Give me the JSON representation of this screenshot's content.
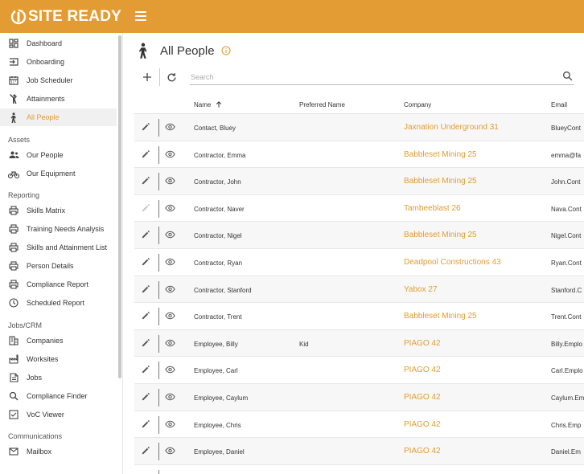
{
  "app": {
    "brand": "SITE READY"
  },
  "colors": {
    "accent": "#E39C33"
  },
  "sidebar": {
    "items": [
      {
        "label": "Dashboard",
        "icon": "dashboard-icon"
      },
      {
        "label": "Onboarding",
        "icon": "login-icon"
      },
      {
        "label": "Job Scheduler",
        "icon": "calendar-icon"
      },
      {
        "label": "Attainments",
        "icon": "person-pose-icon"
      },
      {
        "label": "All People",
        "icon": "person-walking-icon",
        "active": true
      }
    ],
    "sections": {
      "assets": {
        "title": "Assets",
        "items": [
          {
            "label": "Our People",
            "icon": "people-icon"
          },
          {
            "label": "Our Equipment",
            "icon": "bike-icon"
          }
        ]
      },
      "reporting": {
        "title": "Reporting",
        "items": [
          {
            "label": "Skills Matrix",
            "icon": "printer-icon"
          },
          {
            "label": "Training Needs Analysis",
            "icon": "printer-icon"
          },
          {
            "label": "Skills and Attainment List",
            "icon": "printer-icon"
          },
          {
            "label": "Person Details",
            "icon": "printer-icon"
          },
          {
            "label": "Compliance Report",
            "icon": "printer-icon"
          },
          {
            "label": "Scheduled Report",
            "icon": "clock-icon"
          }
        ]
      },
      "jobs": {
        "title": "Jobs/CRM",
        "items": [
          {
            "label": "Companies",
            "icon": "building-icon"
          },
          {
            "label": "Worksites",
            "icon": "factory-icon"
          },
          {
            "label": "Jobs",
            "icon": "document-icon"
          },
          {
            "label": "Compliance Finder",
            "icon": "search-icon"
          },
          {
            "label": "VoC Viewer",
            "icon": "checkbox-icon"
          }
        ]
      },
      "comms": {
        "title": "Communications",
        "items": [
          {
            "label": "Mailbox",
            "icon": "mail-icon"
          }
        ]
      }
    }
  },
  "page": {
    "title": "All People"
  },
  "toolbar": {
    "search_placeholder": "Search"
  },
  "table": {
    "headers": {
      "name": "Name",
      "preferred": "Preferred Name",
      "company": "Company",
      "email": "Email"
    },
    "rows": [
      {
        "name": "Contact, Bluey",
        "preferred": "",
        "company": "Jaxnation Underground 31",
        "email": "BlueyCont",
        "edit_enabled": true
      },
      {
        "name": "Contractor, Emma",
        "preferred": "",
        "company": "Babbleset Mining 25",
        "email": "emma@fa",
        "edit_enabled": true
      },
      {
        "name": "Contractor, John",
        "preferred": "",
        "company": "Babbleset Mining 25",
        "email": "John.Cont",
        "edit_enabled": true
      },
      {
        "name": "Contractor, Naver",
        "preferred": "",
        "company": "Tambeeblast 26",
        "email": "Nava.Cont",
        "edit_enabled": false
      },
      {
        "name": "Contractor, Nigel",
        "preferred": "",
        "company": "Babbleset Mining 25",
        "email": "Nigel.Cont",
        "edit_enabled": true
      },
      {
        "name": "Contractor, Ryan",
        "preferred": "",
        "company": "Deadpool Constructions 43",
        "email": "Ryan.Cont",
        "edit_enabled": true
      },
      {
        "name": "Contractor, Stanford",
        "preferred": "",
        "company": "Yabox 27",
        "email": "Stanford.C",
        "edit_enabled": true
      },
      {
        "name": "Contractor, Trent",
        "preferred": "",
        "company": "Babbleset Mining 25",
        "email": "Trent.Cont",
        "edit_enabled": true
      },
      {
        "name": "Employee, Billy",
        "preferred": "Kid",
        "company": "PIAGO 42",
        "email": "Billy.Emplo",
        "edit_enabled": true
      },
      {
        "name": "Employee, Carl",
        "preferred": "",
        "company": "PIAGO 42",
        "email": "Carl.Emplo",
        "edit_enabled": true
      },
      {
        "name": "Employee, Caylum",
        "preferred": "",
        "company": "PIAGO 42",
        "email": "Caylum.Em",
        "edit_enabled": true
      },
      {
        "name": "Employee, Chris",
        "preferred": "",
        "company": "PIAGO 42",
        "email": "Chris.Emp",
        "edit_enabled": true
      },
      {
        "name": "Employee, Daniel",
        "preferred": "",
        "company": "PIAGO 42",
        "email": "Daniel.Em",
        "edit_enabled": true
      }
    ]
  }
}
